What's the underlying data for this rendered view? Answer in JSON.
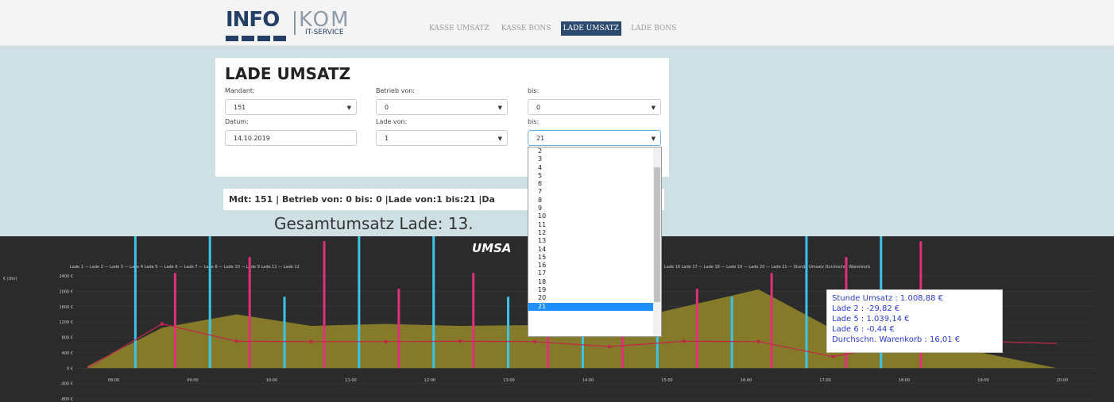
{
  "header": {
    "logo_info": "INFO",
    "logo_kom": "KOM",
    "logo_sub": "IT-SERVICE",
    "nav": [
      "KASSE UMSATZ",
      "KASSE BONS",
      "LADE UMSATZ",
      "LADE BONS"
    ]
  },
  "form": {
    "title": "LADE UMSATZ",
    "mandant_label": "Mandant:",
    "mandant_value": "151",
    "betrieb_von_label": "Betrieb von:",
    "betrieb_von_value": "0",
    "betrieb_bis_label": "bis:",
    "betrieb_bis_value": "0",
    "datum_label": "Datum:",
    "datum_value": "14.10.2019",
    "lade_von_label": "Lade von:",
    "lade_von_value": "1",
    "lade_bis_label": "bis:",
    "lade_bis_value": "21"
  },
  "dropdown": {
    "options": [
      "2",
      "3",
      "4",
      "5",
      "6",
      "7",
      "8",
      "9",
      "10",
      "11",
      "12",
      "13",
      "14",
      "15",
      "16",
      "17",
      "18",
      "19",
      "20",
      "21"
    ],
    "selected": "21"
  },
  "summary": {
    "info": "Mdt: 151 | Betrieb von: 0 bis: 0 |Lade von:1 bis:21 |Da",
    "gesamt": "Gesamtumsatz Lade: 13."
  },
  "chart": {
    "title": "UMSA",
    "legend_left": "Lade 1 — Lade 2 — Lade 3 — Lade 4    Lade 5 — Lade 6 — Lade 7 — Lade 8 — Lade 10 — Lade 9    Lade 11 — Lade 12",
    "legend_right": "Lade 16    Lade 17 — Lade 18 — Lade 19 — Lade 20 — Lade 21 — Stunde Umsatz    Durchschn. Warenkorb",
    "tooltip": [
      "Stunde Umsatz : 1.008,88 €",
      "Lade 2 : -29,82 €",
      "Lade 5 : 1.039,14 €",
      "Lade 6 : -0,44 €",
      "Durchschn. Warenkorb : 16,01 €"
    ],
    "colors": {
      "area": "#8a7d2a",
      "line": "#c0284a",
      "cyan": "#3cc5e8",
      "pink": "#e0307a",
      "yellow": "#e6d84a"
    }
  },
  "chart_data": {
    "type": "area",
    "x": [
      "08:00",
      "09:00",
      "10:00",
      "11:00",
      "12:00",
      "13:00",
      "14:00",
      "15:00",
      "16:00",
      "17:00",
      "18:00",
      "19:00",
      "20:00"
    ],
    "ylabel_left": "€ (Uhr)",
    "y_ticks": [
      "2400 €",
      "2000 €",
      "1600 €",
      "1200 €",
      "800 €",
      "400 €",
      "0 €",
      "-400 €",
      "-800 €"
    ],
    "ylim": [
      -800,
      2400
    ],
    "series": [
      {
        "name": "Stunde Umsatz",
        "values": [
          50,
          1050,
          1400,
          1100,
          1150,
          1100,
          1120,
          1150,
          1600,
          2050,
          1008.88,
          750,
          400,
          0
        ]
      },
      {
        "name": "Durchschn. Warenkorb",
        "values": [
          0,
          1150,
          700,
          690,
          690,
          700,
          690,
          560,
          700,
          690,
          300,
          660,
          700,
          640
        ]
      }
    ]
  }
}
